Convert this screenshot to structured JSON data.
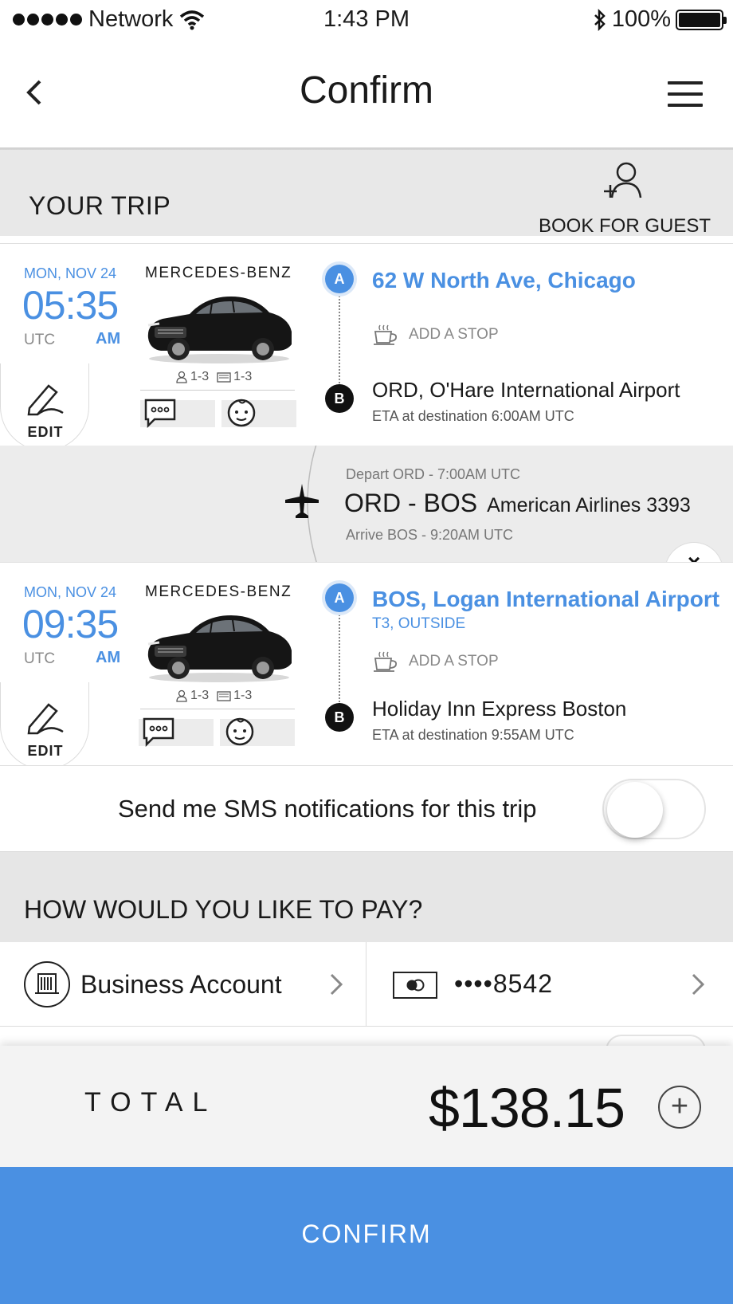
{
  "status_bar": {
    "carrier": "Network",
    "time": "1:43 PM",
    "battery": "100%"
  },
  "nav": {
    "title": "Confirm"
  },
  "trip": {
    "header_title": "YOUR TRIP",
    "guest_label": "BOOK FOR GUEST",
    "segments": [
      {
        "date": "MON, NOV 24",
        "time": "05:35",
        "tz": "UTC",
        "ampm": "AM",
        "edit_label": "EDIT",
        "car_brand": "MERCEDES-BENZ",
        "passengers": "1-3",
        "luggage": "1-3",
        "pickup_pin": "A",
        "pickup": "62 W North Ave, Chicago",
        "pickup_sub": "",
        "add_stop": "ADD A STOP",
        "dropoff_pin": "B",
        "dropoff": "ORD, O'Hare International Airport",
        "eta": "ETA at destination 6:00AM UTC"
      },
      {
        "date": "MON, NOV 24",
        "time": "09:35",
        "tz": "UTC",
        "ampm": "AM",
        "edit_label": "EDIT",
        "car_brand": "MERCEDES-BENZ",
        "passengers": "1-3",
        "luggage": "1-3",
        "pickup_pin": "A",
        "pickup": "BOS, Logan International Airport",
        "pickup_sub": "T3, OUTSIDE",
        "add_stop": "ADD A STOP",
        "dropoff_pin": "B",
        "dropoff": "Holiday Inn Express Boston",
        "eta": "ETA at destination 9:55AM UTC"
      }
    ],
    "flight": {
      "depart": "Depart ORD - 7:00AM UTC",
      "route": "ORD - BOS",
      "airline": "American Airlines 3393",
      "arrive": "Arrive BOS - 9:20AM UTC",
      "remove_label": "×"
    }
  },
  "sms": {
    "label": "Send me SMS notifications for this trip",
    "enabled": false
  },
  "payment": {
    "title": "HOW WOULD YOU LIKE TO PAY?",
    "account": "Business Account",
    "card": "••••8542"
  },
  "total": {
    "label": "TOTAL",
    "amount": "$138.15",
    "expand_label": "+"
  },
  "confirm_label": "CONFIRM",
  "colors": {
    "accent": "#4a90e2",
    "header_bg": "#e8e8e8",
    "text": "#1a1a1a"
  }
}
